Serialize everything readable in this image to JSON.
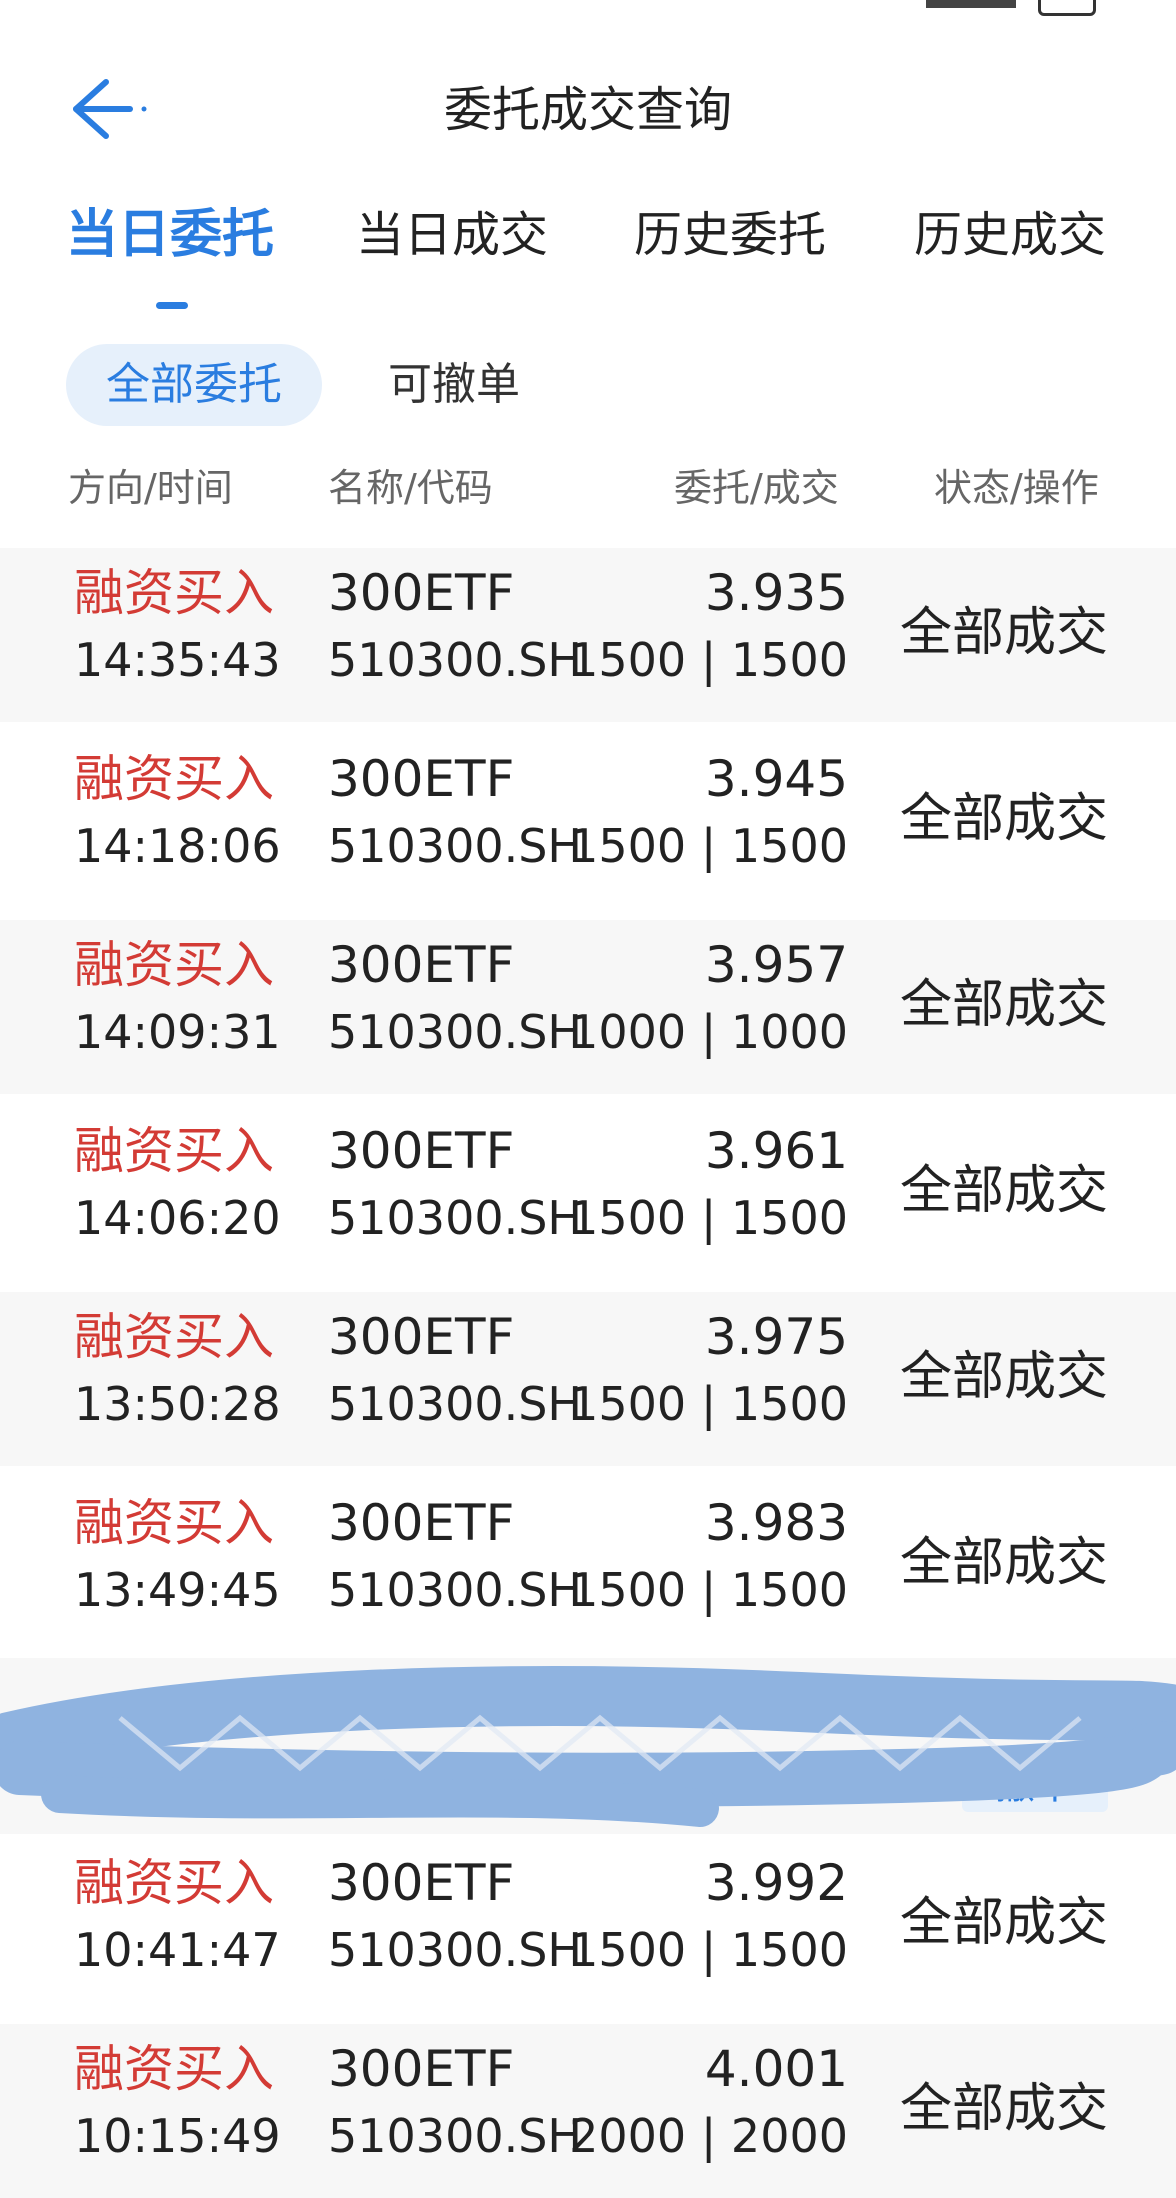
{
  "header": {
    "title": "委托成交查询"
  },
  "tabs": [
    {
      "label": "当日委托",
      "active": true
    },
    {
      "label": "当日成交",
      "active": false
    },
    {
      "label": "历史委托",
      "active": false
    },
    {
      "label": "历史成交",
      "active": false
    }
  ],
  "filters": {
    "all_label": "全部委托",
    "cancelable_label": "可撤单"
  },
  "columns": {
    "direction_time": "方向/时间",
    "name_code": "名称/代码",
    "order_fill": "委托/成交",
    "status_action": "状态/操作"
  },
  "orders": [
    {
      "direction": "融资买入",
      "time": "14:35:43",
      "name": "300ETF",
      "code": "510300.SH",
      "price": "3.935",
      "qty": "1500 | 1500",
      "status": "全部成交"
    },
    {
      "direction": "融资买入",
      "time": "14:18:06",
      "name": "300ETF",
      "code": "510300.SH",
      "price": "3.945",
      "qty": "1500 | 1500",
      "status": "全部成交"
    },
    {
      "direction": "融资买入",
      "time": "14:09:31",
      "name": "300ETF",
      "code": "510300.SH",
      "price": "3.957",
      "qty": "1000 | 1000",
      "status": "全部成交"
    },
    {
      "direction": "融资买入",
      "time": "14:06:20",
      "name": "300ETF",
      "code": "510300.SH",
      "price": "3.961",
      "qty": "1500 | 1500",
      "status": "全部成交"
    },
    {
      "direction": "融资买入",
      "time": "13:50:28",
      "name": "300ETF",
      "code": "510300.SH",
      "price": "3.975",
      "qty": "1500 | 1500",
      "status": "全部成交"
    },
    {
      "direction": "融资买入",
      "time": "13:49:45",
      "name": "300ETF",
      "code": "510300.SH",
      "price": "3.983",
      "qty": "1500 | 1500",
      "status": "全部成交"
    },
    {
      "direction": "融资买入",
      "time": "10:41:47",
      "name": "300ETF",
      "code": "510300.SH",
      "price": "3.992",
      "qty": "1500 | 1500",
      "status": "全部成交"
    },
    {
      "direction": "融资买入",
      "time": "10:15:49",
      "name": "300ETF",
      "code": "510300.SH",
      "price": "4.001",
      "qty": "2000 | 2000",
      "status": "全部成交"
    }
  ],
  "redacted_row": {
    "cancel_label": "撤单"
  },
  "colors": {
    "accent": "#2a7de0",
    "buy_red": "#d33b35",
    "redaction": "#8fb3e0"
  }
}
